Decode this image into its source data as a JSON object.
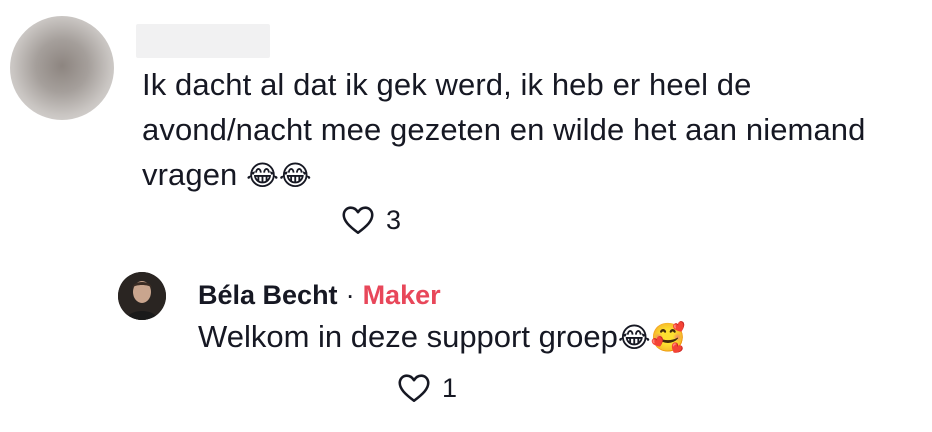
{
  "comment": {
    "text_line1": "Ik dacht al dat ik gek werd, ik heb er heel de",
    "text_line2": "avond/nacht mee gezeten en wilde het aan niemand",
    "text_line3": "vragen",
    "emojis": "😂😂",
    "like_count": "3"
  },
  "reply": {
    "author": "Béla Becht",
    "separator": "·",
    "badge": "Maker",
    "text": "Welkom in deze support groep",
    "emojis": "😂🥰",
    "like_count": "1"
  },
  "colors": {
    "text": "#161823",
    "creator_badge": "#e8475a",
    "icon": "#161823"
  },
  "icons": {
    "like": "heart-outline-icon"
  }
}
